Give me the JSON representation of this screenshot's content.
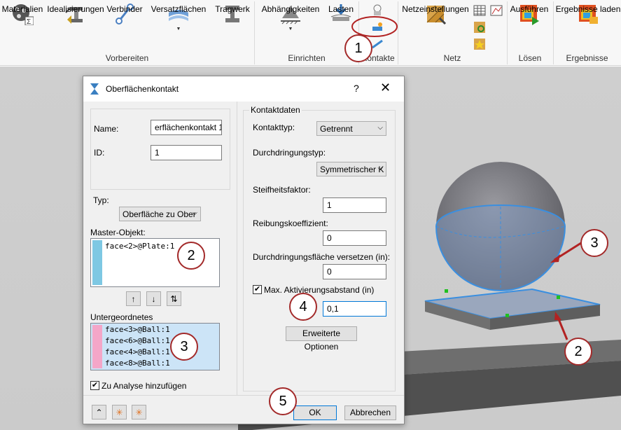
{
  "ribbon": {
    "buttons": [
      {
        "label": "Materialien",
        "icon": "materials-icon"
      },
      {
        "label": "Idealisierungen",
        "icon": "idealizations-icon"
      },
      {
        "label": "Verbinder",
        "icon": "connector-icon"
      },
      {
        "label": "Versatzflächen",
        "icon": "offset-surfaces-icon"
      },
      {
        "label": "Tragwerk",
        "icon": "structure-icon"
      },
      {
        "label": "Abhängigkeiten",
        "icon": "constraints-icon"
      },
      {
        "label": "Lasten",
        "icon": "loads-icon"
      },
      {
        "label": "Netzeinstellungen",
        "icon": "mesh-settings-icon"
      },
      {
        "label": "Ausführen",
        "icon": "solve-icon"
      },
      {
        "label": "Ergebnisse laden",
        "icon": "load-results-icon"
      }
    ],
    "groups": {
      "vorbereiten": "Vorbereiten",
      "einrichten": "Einrichten",
      "kontakte": "Kontakte",
      "netz": "Netz",
      "loesen": "Lösen",
      "ergebnisse": "Ergebnisse"
    }
  },
  "dialog": {
    "title": "Oberflächenkontakt",
    "help": "?",
    "close": "✕",
    "left": {
      "name_label": "Name:",
      "name_value": "erflächenkontakt 1",
      "id_label": "ID:",
      "id_value": "1",
      "typ_label": "Typ:",
      "typ_value": "Oberfläche zu Ober",
      "master_label": "Master-Objekt:",
      "master_items": [
        "face<2>@Plate:1"
      ],
      "subordinate_label": "Untergeordnetes",
      "subordinate_items": [
        "face<3>@Ball:1",
        "face<6>@Ball:1",
        "face<4>@Ball:1",
        "face<8>@Ball:1"
      ],
      "add_to_analysis_label": "Zu Analyse hinzufügen",
      "add_to_analysis_checked": true
    },
    "right": {
      "group_title": "Kontaktdaten",
      "contact_type_label": "Kontakttyp:",
      "contact_type_value": "Getrennt",
      "penetration_type_label": "Durchdringungstyp:",
      "penetration_type_value": "Symmetrischer K",
      "stiffness_label": "Steifheitsfaktor:",
      "stiffness_value": "1",
      "friction_label": "Reibungskoeffizient:",
      "friction_value": "0",
      "offset_label": "Durchdringungsfläche versetzen (in):",
      "offset_value": "0",
      "max_activation_label": "Max. Aktivierungsabstand (in)",
      "max_activation_checked": true,
      "max_activation_value": "0,1",
      "advanced_button": "Erweiterte Optionen"
    },
    "footer": {
      "ok": "OK",
      "cancel": "Abbrechen"
    }
  },
  "callouts": [
    "1",
    "2",
    "3",
    "4",
    "5",
    "3",
    "2"
  ],
  "colors": {
    "master_bar": "#7ec8e3",
    "subordinate_bar": "#f4a6c8",
    "selection": "#cce4f7",
    "callout_border": "#a32a2a",
    "arrow": "#b22222"
  }
}
